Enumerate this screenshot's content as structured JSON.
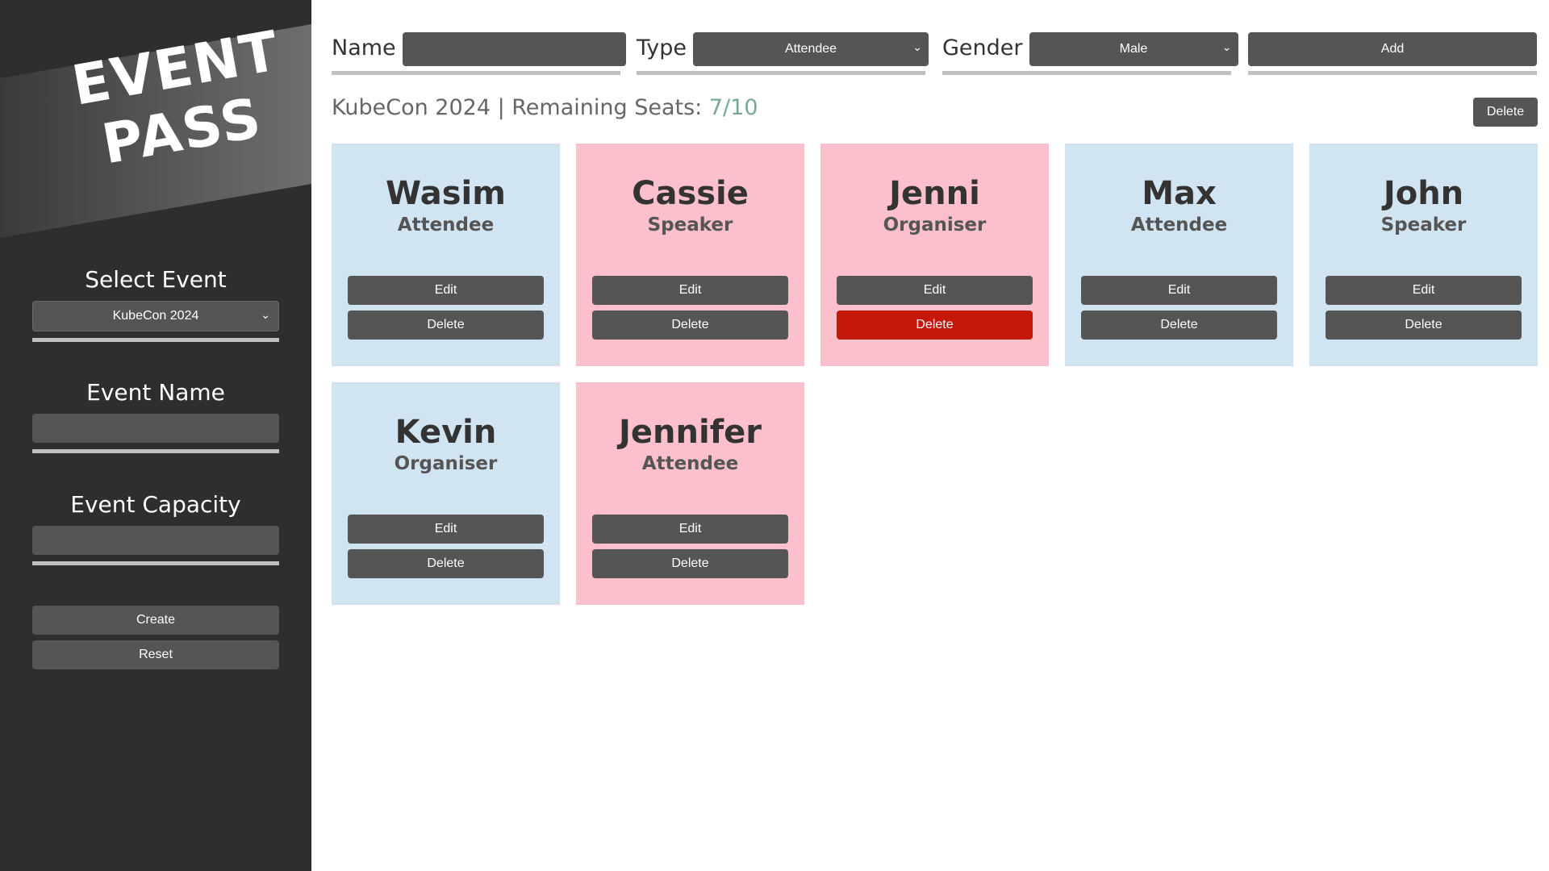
{
  "sidebar": {
    "logo_line1": "EVENT",
    "logo_line2": "PASS",
    "select_event_label": "Select Event",
    "selected_event": "KubeCon 2024",
    "event_name_label": "Event Name",
    "event_capacity_label": "Event Capacity",
    "create_label": "Create",
    "reset_label": "Reset"
  },
  "form": {
    "name_label": "Name",
    "type_label": "Type",
    "type_value": "Attendee",
    "gender_label": "Gender",
    "gender_value": "Male",
    "add_label": "Add"
  },
  "event": {
    "title": "KubeCon 2024 | Remaining Seats: ",
    "seats": "7/10",
    "delete_label": "Delete"
  },
  "cards": [
    {
      "name": "Wasim",
      "role": "Attendee",
      "edit": "Edit",
      "delete": "Delete",
      "color": "#d1e4f1"
    },
    {
      "name": "Cassie",
      "role": "Speaker",
      "edit": "Edit",
      "delete": "Delete",
      "color": "#fbc0cb"
    },
    {
      "name": "Jenni",
      "role": "Organiser",
      "edit": "Edit",
      "delete": "Delete",
      "color": "#fbc0cb",
      "delete_color": "#c5170a"
    },
    {
      "name": "Max",
      "role": "Attendee",
      "edit": "Edit",
      "delete": "Delete",
      "color": "#d1e4f1"
    },
    {
      "name": "John",
      "role": "Speaker",
      "edit": "Edit",
      "delete": "Delete",
      "color": "#d1e4f1"
    },
    {
      "name": "Kevin",
      "role": "Organiser",
      "edit": "Edit",
      "delete": "Delete",
      "color": "#d1e4f1"
    },
    {
      "name": "Jennifer",
      "role": "Attendee",
      "edit": "Edit",
      "delete": "Delete",
      "color": "#fbc0cb"
    }
  ],
  "colors": {
    "sidebar_bg": "#2e2e2e",
    "button_bg": "#555555",
    "danger": "#c5170a",
    "male_card": "#d1e4f1",
    "female_card": "#fbc0cb",
    "seats_accent": "#76a89a"
  }
}
